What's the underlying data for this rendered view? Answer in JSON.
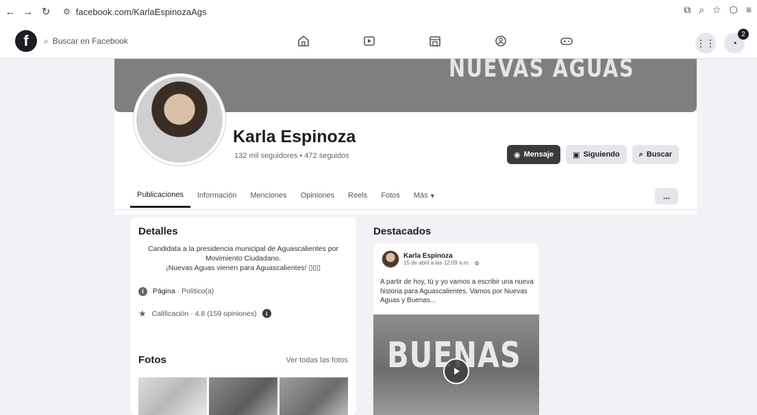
{
  "browser": {
    "url": "facebook.com/KarlaEspinozaAgs"
  },
  "fb_nav": {
    "logo": "f",
    "search_placeholder": "Buscar en Facebook",
    "notification_count": "2"
  },
  "cover": {
    "text": "NUEVAS AGUAS"
  },
  "profile": {
    "name": "Karla Espinoza",
    "stats": "132 mil seguidores • 472 seguidos"
  },
  "actions": {
    "message": "Mensaje",
    "following": "Siguiendo",
    "search": "Buscar"
  },
  "tabs": [
    {
      "label": "Publicaciones"
    },
    {
      "label": "Información"
    },
    {
      "label": "Menciones"
    },
    {
      "label": "Opiniones"
    },
    {
      "label": "Reels"
    },
    {
      "label": "Fotos"
    },
    {
      "label": "Más"
    }
  ],
  "tabs_more": "...",
  "details": {
    "title": "Detalles",
    "bio_line1": "Candidata a la presidencia municipal de Aguascalientes por",
    "bio_line2": "Movimiento Ciudadano.",
    "bio_line3": "¡Nuevas Aguas vienen para Aguascalientes! ▯▯▯",
    "page_label": "Página",
    "page_category": " · Político(a)",
    "rating": "Calificación · 4.8 (159 opiniones)"
  },
  "photos": {
    "title": "Fotos",
    "see_all": "Ver todas las fotos"
  },
  "featured": {
    "title": "Destacados",
    "author": "Karla Espinoza",
    "date": "15 de abril a las 12:09 a.m. · ",
    "text": "A partir de hoy, tú y yo vamos a escribir una nueva historia para Aguascalientes. Vamos por Nuevas Aguas y Buenas...",
    "image_text": "BUENAS"
  }
}
